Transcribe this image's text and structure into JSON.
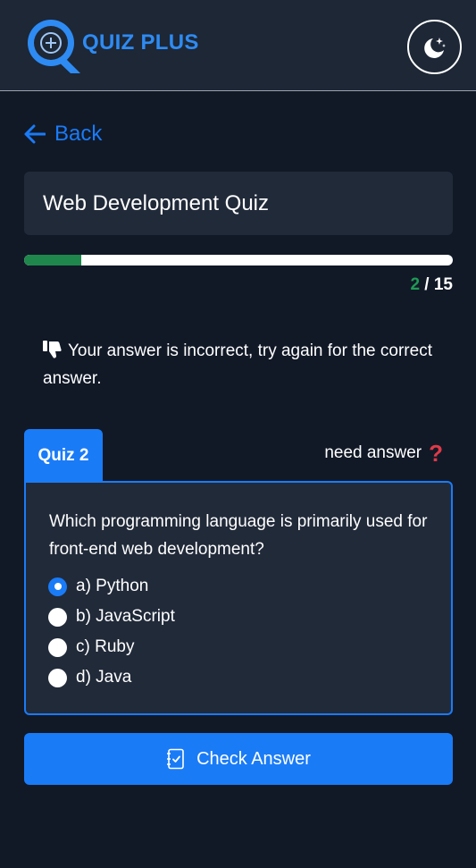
{
  "header": {
    "brand": "QUIZ PLUS",
    "logo_icon": "quiz-plus-logo-icon",
    "theme_icon": "moon-stars-icon"
  },
  "nav": {
    "back_label": "Back",
    "back_icon": "arrow-left-icon"
  },
  "quiz": {
    "title": "Web Development Quiz",
    "progress": {
      "current": "2",
      "separator": " / ",
      "total": "15",
      "fill_fraction": 0.133
    },
    "feedback": {
      "icon": "thumbs-down-icon",
      "text": "Your answer is incorrect, try again for the correct answer."
    },
    "tab_label": "Quiz 2",
    "need_answer_label": "need answer",
    "need_answer_icon": "question-mark-icon",
    "question": "Which programming language is primarily used for front-end web development?",
    "options": [
      {
        "label": "a) Python",
        "selected": true
      },
      {
        "label": "b) JavaScript",
        "selected": false
      },
      {
        "label": "c) Ruby",
        "selected": false
      },
      {
        "label": "d) Java",
        "selected": false
      }
    ],
    "check_button_label": "Check Answer",
    "check_button_icon": "checklist-icon"
  },
  "colors": {
    "background": "#111927",
    "header": "#1d2736",
    "card": "#212a39",
    "accent": "#1a7bf7",
    "progress": "#1f874c",
    "error": "#e03a48"
  }
}
